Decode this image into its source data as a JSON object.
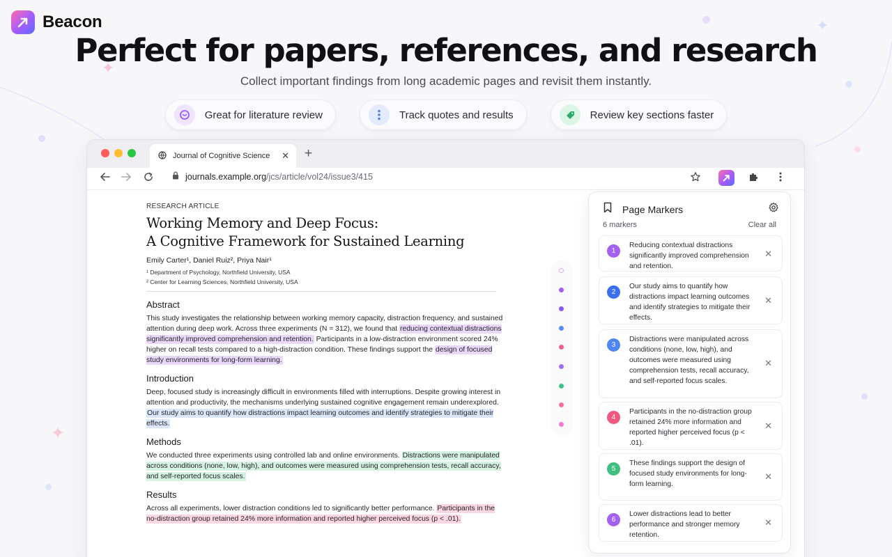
{
  "brand": {
    "name": "Beacon"
  },
  "hero": {
    "title": "Perfect for papers, references, and research",
    "subtitle": "Collect important findings from long academic pages and revisit them instantly."
  },
  "features": [
    {
      "label": "Great for literature review",
      "icon": "focus-circle-icon",
      "color": "#9a5cf5"
    },
    {
      "label": "Track quotes and results",
      "icon": "vertical-dots-icon",
      "color": "#4f7df2"
    },
    {
      "label": "Review key sections faster",
      "icon": "tag-icon",
      "color": "#2ea86a"
    }
  ],
  "browser": {
    "tab_title": "Journal of Cognitive Science",
    "url_domain": "journals.example.org",
    "url_path": "/jcs/article/vol24/issue3/415"
  },
  "article": {
    "kicker": "RESEARCH ARTICLE",
    "title_line1": "Working Memory and Deep Focus:",
    "title_line2": "A Cognitive Framework for Sustained Learning",
    "authors": "Emily Carter¹, Daniel Ruiz², Priya Nair¹",
    "affil1": "¹ Department of Psychology, Northfield University, USA",
    "affil2": "² Center for Learning Sciences, Northfield University, USA",
    "abstract": {
      "heading": "Abstract",
      "t1": "This study investigates the relationship between working memory capacity, distraction frequency, and sustained attention during deep work. Across three experiments (N = 312), we found that ",
      "h1": "reducing contextual distractions significantly improved comprehension and retention.",
      "t2": " Participants in a low-distraction environment scored 24% higher on recall tests compared to a high-distraction condition. These findings support the ",
      "h2": "design of focused study environments for long-form learning."
    },
    "introduction": {
      "heading": "Introduction",
      "t1": "Deep, focused study is increasingly difficult in environments filled with interruptions. Despite growing interest in attention and productivity, the mechanisms underlying sustained cognitive engagement remain underexplored. ",
      "h1": "Our study aims to quantify how distractions impact learning outcomes and identify strategies to mitigate their effects."
    },
    "methods": {
      "heading": "Methods",
      "t1": "We conducted three experiments using controlled lab and online environments. ",
      "h1": "Distractions were manipulated across conditions (none, low, high), and outcomes were measured using comprehension tests, recall accuracy, and self-reported focus scales."
    },
    "results": {
      "heading": "Results",
      "t1": "Across all experiments, lower distraction conditions led to significantly better performance. ",
      "h1": "Participants in the no-distraction group retained 24% more information and reported higher perceived focus (p < .01)."
    }
  },
  "rail_colors": [
    "#d9a8f5",
    "#a35cf2",
    "#8a5cf0",
    "#5a8df2",
    "#f0608f",
    "#a070f0",
    "#3fc187",
    "#f2709a",
    "#f27ad8"
  ],
  "panel": {
    "title": "Page Markers",
    "count": "6 markers",
    "clear": "Clear all",
    "markers": [
      {
        "num": "1",
        "color": "#a461f0",
        "text": "Reducing contextual distractions significantly improved comprehension and retention."
      },
      {
        "num": "2",
        "color": "#3b6ff0",
        "text": "Our study aims to quantify how distractions impact learning outcomes and identify strategies to mitigate their effects."
      },
      {
        "num": "3",
        "color": "#4e87f2",
        "text": "Distractions were manipulated across conditions (none, low, high), and outcomes were measured using comprehension tests, recall accuracy, and self-reported focus scales."
      },
      {
        "num": "4",
        "color": "#f0587f",
        "text": "Participants in the no-distraction group retained 24% more information and reported higher perceived focus (p < .01)."
      },
      {
        "num": "5",
        "color": "#3fbf80",
        "text": "These findings support the design of focused study environments for long-form learning."
      },
      {
        "num": "6",
        "color": "#a461f0",
        "text": "Lower distractions lead to better performance and stronger memory retention."
      }
    ]
  }
}
